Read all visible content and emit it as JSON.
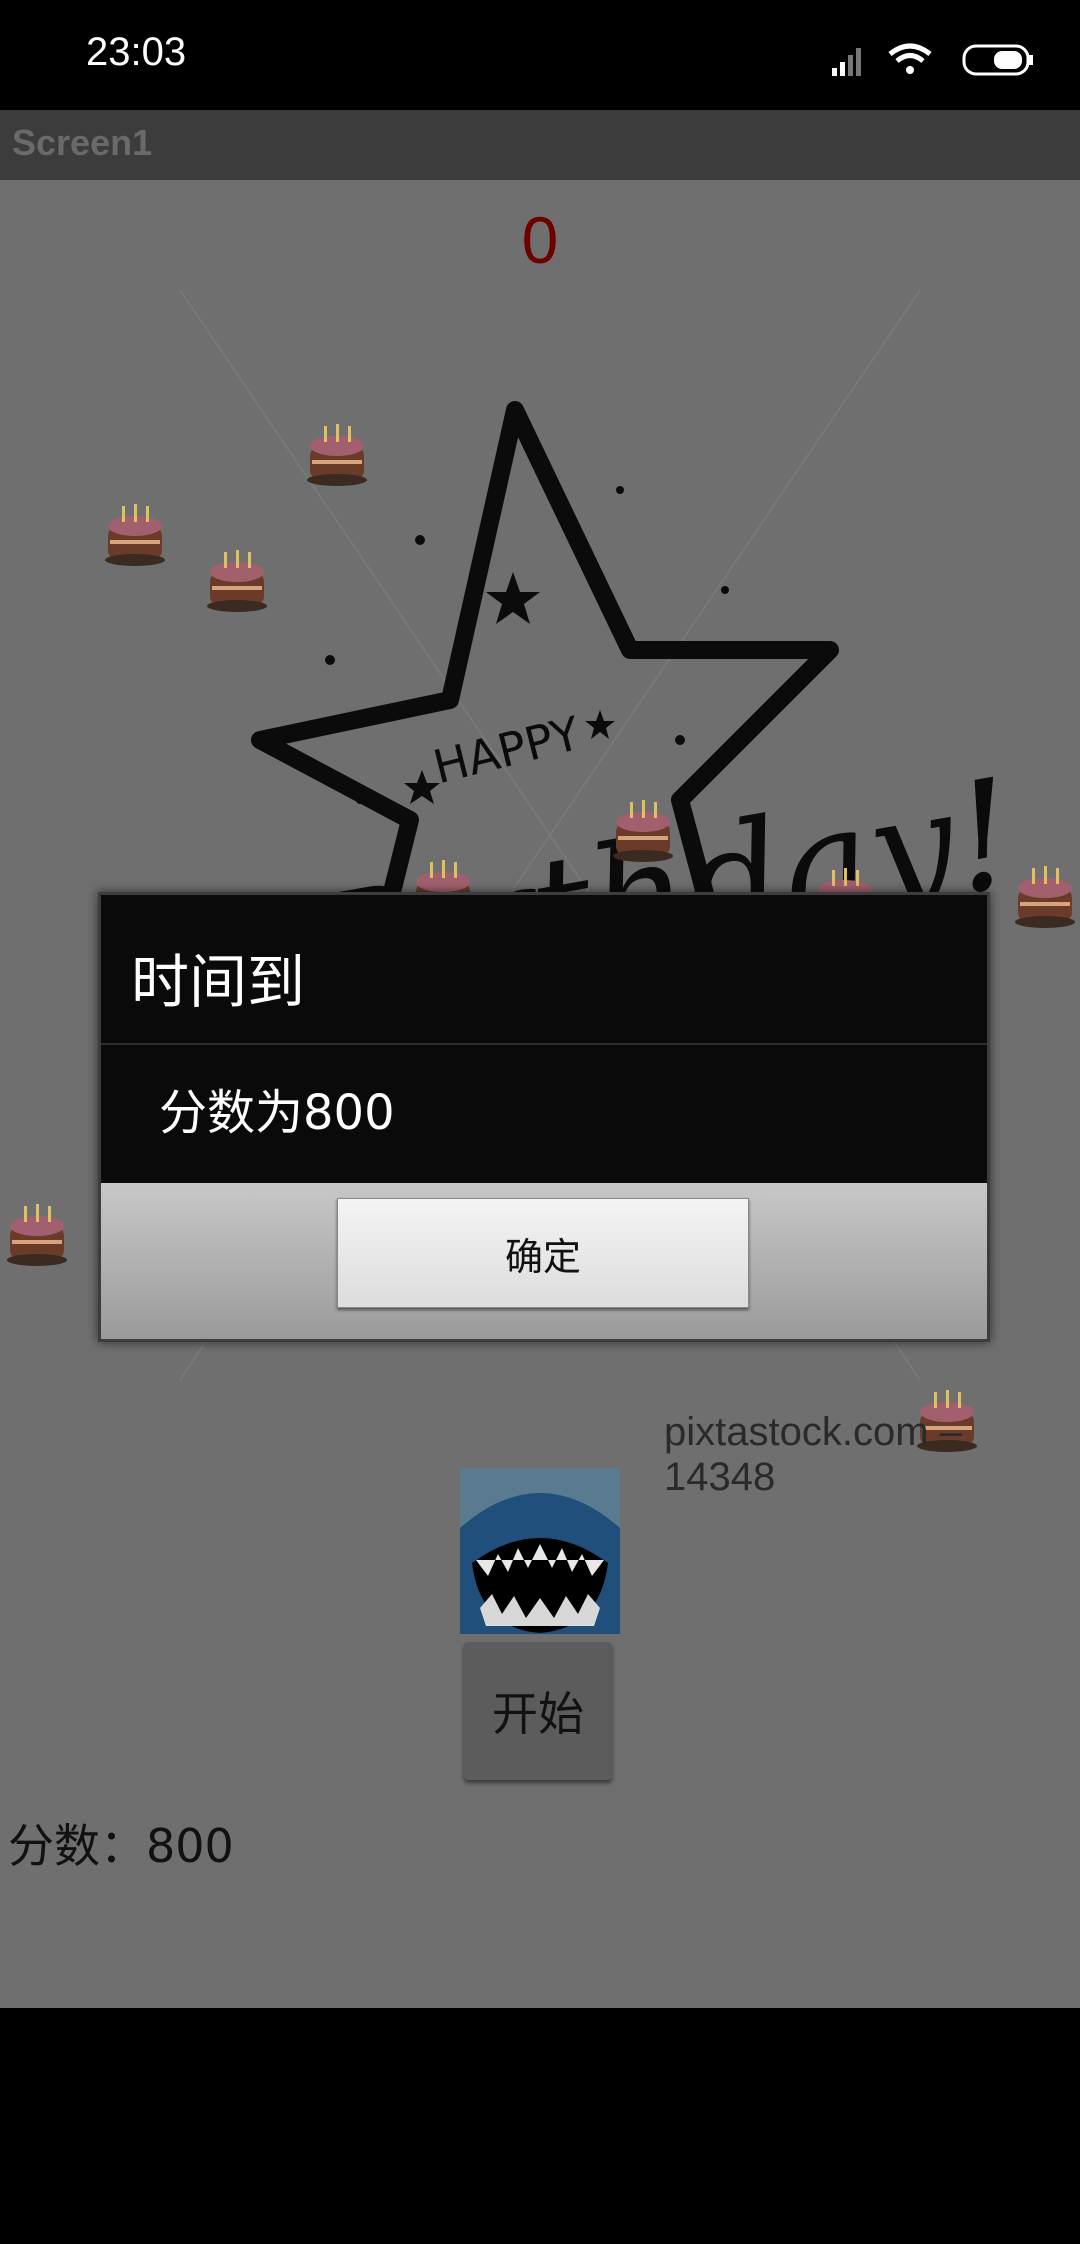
{
  "status_bar": {
    "time": "23:03"
  },
  "app_bar": {
    "title": "Screen1"
  },
  "game": {
    "top_score": "0",
    "watermark": "pixtastock.com – 14348",
    "start_button": "开始",
    "score_label": "分数：",
    "score_value": "800"
  },
  "dialog": {
    "title": "时间到",
    "message": "分数为800",
    "ok_button": "确定"
  },
  "colors": {
    "overlay_bg": "#6f6f6f",
    "score_red": "#6e0000"
  }
}
